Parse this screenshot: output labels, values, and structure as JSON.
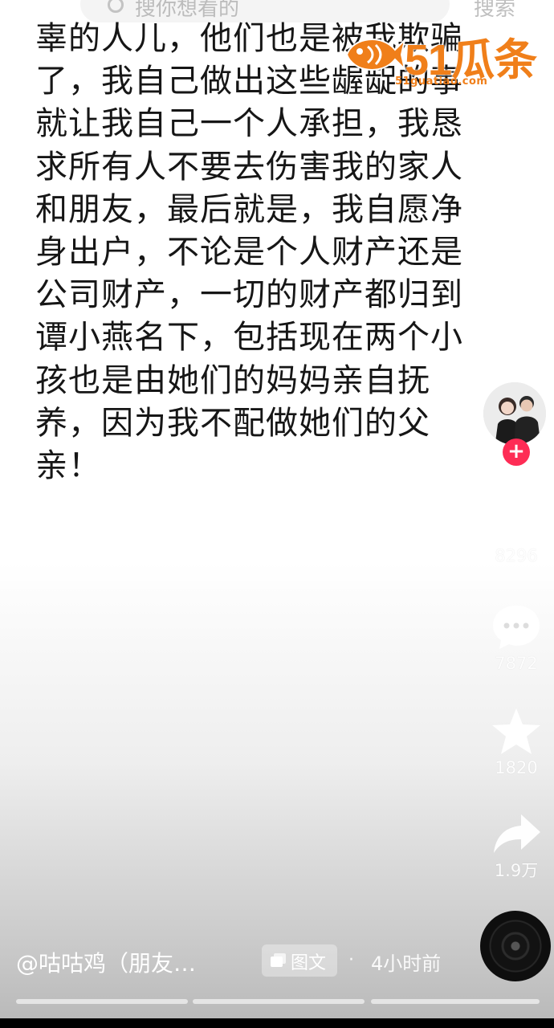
{
  "search": {
    "placeholder": "搜你想看的",
    "button_label": "搜索"
  },
  "watermark": {
    "logo_text": "51瓜条",
    "logo_sub": "51guatiao.com"
  },
  "post": {
    "lines": [
      "辜的人儿，他们也是被我欺骗",
      "了，我自己做出这些龌龊的事",
      "就让我自己一个人承担，我恳",
      "求所有人不要去伤害我的家人",
      "和朋友，最后就是，我自愿净",
      "身出户，不论是个人财产还是",
      "公司财产，一切的财产都归到",
      "谭小燕名下，包括现在两个小",
      "孩也是由她们的妈妈亲自抚",
      "养，因为我不配做她们的父",
      "亲！"
    ]
  },
  "actions": {
    "follow_symbol": "+",
    "likes": "8296",
    "comments": "7872",
    "favorites": "1820",
    "shares": "1.9万"
  },
  "footer": {
    "author": "@咕咕鸡（朋友…",
    "tag": "图文",
    "dot": "·",
    "time": "4小时前"
  },
  "progress": {
    "segments": 3
  },
  "icons": {
    "back": "back-chevron-icon",
    "search": "search-icon",
    "like": "heart-icon",
    "comment": "comment-bubble-icon",
    "favorite": "star-icon",
    "share": "share-arrow-icon",
    "tag": "image-stack-icon",
    "music": "music-disc-icon"
  },
  "colors": {
    "follow": "#fe2c55",
    "logo": "#f07f1a"
  }
}
